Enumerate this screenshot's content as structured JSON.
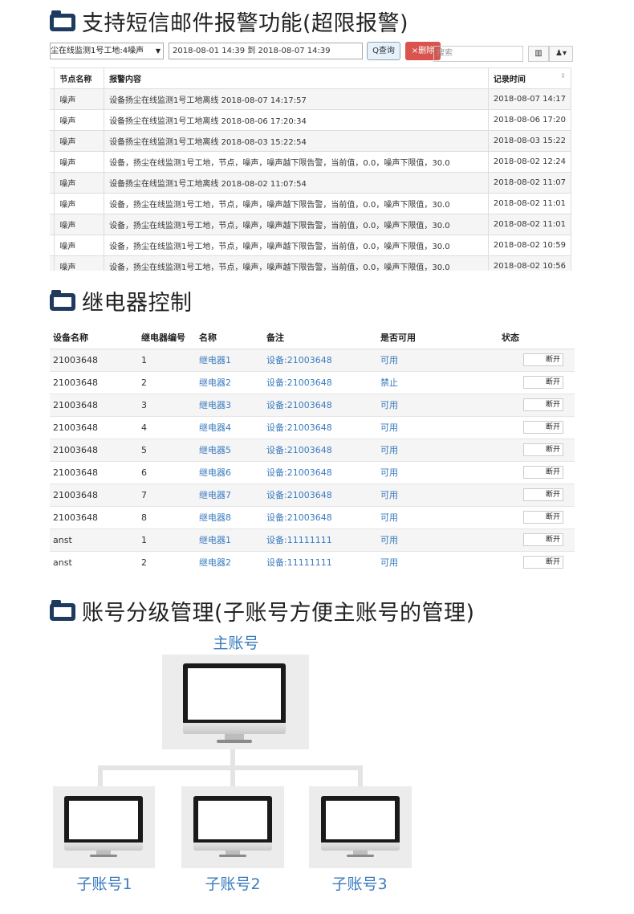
{
  "sections": {
    "alarm_title": "支持短信邮件报警功能(超限报警)",
    "relay_title": "继电器控制",
    "account_title": "账号分级管理(子账号方便主账号的管理)"
  },
  "toolbar": {
    "select_value": "尘在线监测1号工地:4噪声",
    "date_range": "2018-08-01 14:39 到 2018-08-07 14:39",
    "query_label": "Q查询",
    "delete_label": "×删除",
    "search_placeholder": "搜索",
    "columns_icon": "columns-icon",
    "export_icon": "user-dropdown-icon"
  },
  "alarm_table": {
    "headers": [
      "节点名称",
      "报警内容",
      "记录时间"
    ],
    "rows": [
      [
        "噪声",
        "设备扬尘在线监测1号工地离线 2018-08-07 14:17:57",
        "2018-08-07 14:17"
      ],
      [
        "噪声",
        "设备扬尘在线监测1号工地离线 2018-08-06 17:20:34",
        "2018-08-06 17:20"
      ],
      [
        "噪声",
        "设备扬尘在线监测1号工地离线 2018-08-03 15:22:54",
        "2018-08-03 15:22"
      ],
      [
        "噪声",
        "设备，扬尘在线监测1号工地，节点，噪声，噪声越下限告警，当前值，0.0，噪声下限值，30.0",
        "2018-08-02 12:24"
      ],
      [
        "噪声",
        "设备扬尘在线监测1号工地离线 2018-08-02 11:07:54",
        "2018-08-02 11:07"
      ],
      [
        "噪声",
        "设备，扬尘在线监测1号工地，节点，噪声，噪声越下限告警，当前值，0.0，噪声下限值，30.0",
        "2018-08-02 11:01"
      ],
      [
        "噪声",
        "设备，扬尘在线监测1号工地，节点，噪声，噪声越下限告警，当前值，0.0，噪声下限值，30.0",
        "2018-08-02 11:01"
      ],
      [
        "噪声",
        "设备，扬尘在线监测1号工地，节点，噪声，噪声越下限告警，当前值，0.0，噪声下限值，30.0",
        "2018-08-02 10:59"
      ],
      [
        "噪声",
        "设备，扬尘在线监测1号工地，节点，噪声，噪声越下限告警，当前值，0.0，噪声下限值，30.0",
        "2018-08-02 10:56"
      ]
    ]
  },
  "relay_table": {
    "headers": [
      "设备名称",
      "继电器编号",
      "名称",
      "备注",
      "是否可用",
      "状态"
    ],
    "button_label": "断开",
    "rows": [
      [
        "21003648",
        "1",
        "继电器1",
        "设备:21003648",
        "可用"
      ],
      [
        "21003648",
        "2",
        "继电器2",
        "设备:21003648",
        "禁止"
      ],
      [
        "21003648",
        "3",
        "继电器3",
        "设备:21003648",
        "可用"
      ],
      [
        "21003648",
        "4",
        "继电器4",
        "设备:21003648",
        "可用"
      ],
      [
        "21003648",
        "5",
        "继电器5",
        "设备:21003648",
        "可用"
      ],
      [
        "21003648",
        "6",
        "继电器6",
        "设备:21003648",
        "可用"
      ],
      [
        "21003648",
        "7",
        "继电器7",
        "设备:21003648",
        "可用"
      ],
      [
        "21003648",
        "8",
        "继电器8",
        "设备:21003648",
        "可用"
      ],
      [
        "anst",
        "1",
        "继电器1",
        "设备:11111111",
        "可用"
      ],
      [
        "anst",
        "2",
        "继电器2",
        "设备:11111111",
        "可用"
      ]
    ]
  },
  "accounts": {
    "main": "主账号",
    "subs": [
      "子账号1",
      "子账号2",
      "子账号3"
    ]
  }
}
